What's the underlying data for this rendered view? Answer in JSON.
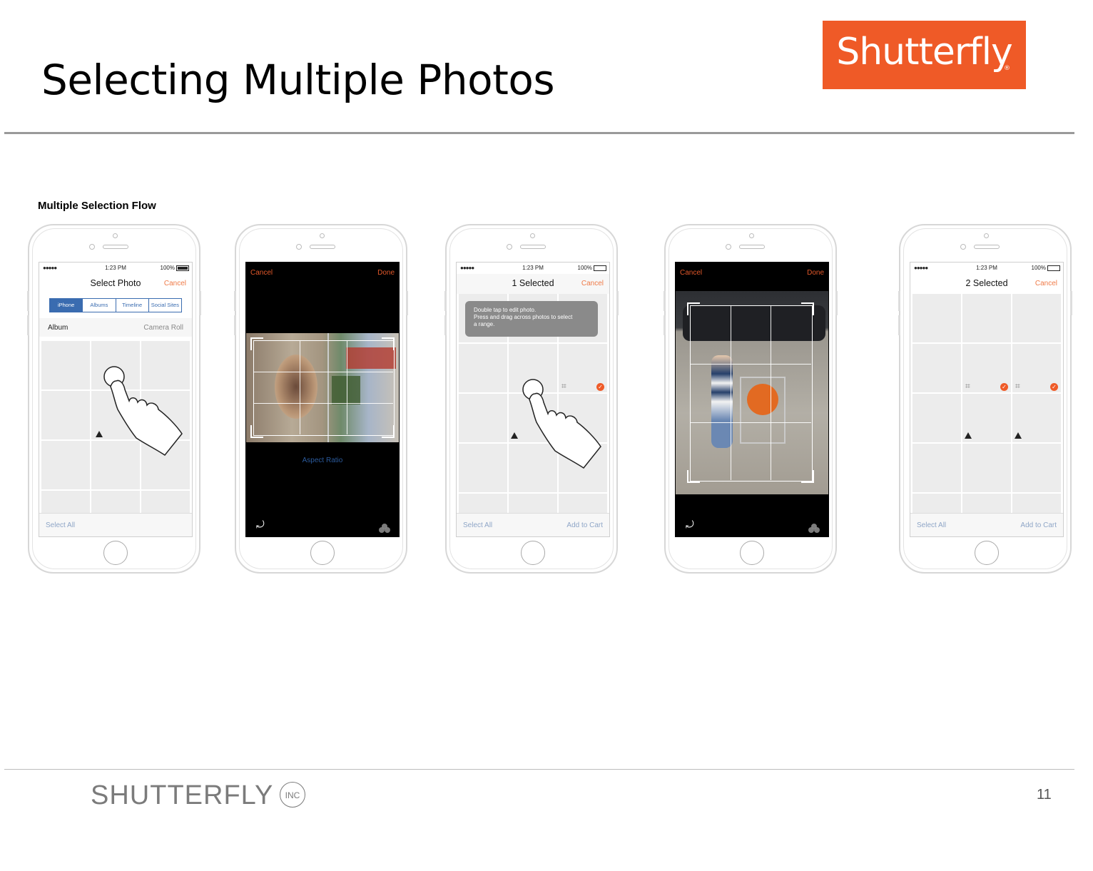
{
  "slide": {
    "title": "Selecting Multiple Photos",
    "page_number": "11"
  },
  "logo": {
    "text": "Shutterfly",
    "reg": "®",
    "color": "#ef5a27"
  },
  "footer": {
    "brand": "SHUTTERFLY",
    "inc": "INC"
  },
  "flow_heading": "Multiple Selection Flow",
  "colors": {
    "accent": "#ef5a27",
    "link_blue": "#3a6cb0",
    "toolbar_text": "#8fa6c7"
  },
  "phones": {
    "p1": {
      "status": {
        "dots": "●●●●●",
        "time": "1:23 PM",
        "battery": "100%"
      },
      "title": "Select Photo",
      "cancel": "Cancel",
      "segments": [
        "iPhone",
        "Albums",
        "Timeline",
        "Social Sites"
      ],
      "album_label": "Album",
      "album_value": "Camera Roll",
      "toolbar_left": "Select All"
    },
    "p2": {
      "cancel": "Cancel",
      "done": "Done",
      "aspect": "Aspect Ratio"
    },
    "p3": {
      "status": {
        "dots": "●●●●●",
        "time": "1:23 PM",
        "battery": "100%"
      },
      "title": "1 Selected",
      "cancel": "Cancel",
      "tooltip_line1": "Double tap to edit photo.",
      "tooltip_line2": "Press and drag across photos to select",
      "tooltip_line3": "a range.",
      "toolbar_left": "Select All",
      "toolbar_right": "Add to Cart"
    },
    "p4": {
      "cancel": "Cancel",
      "done": "Done"
    },
    "p5": {
      "status": {
        "dots": "●●●●●",
        "time": "1:23 PM",
        "battery": "100%"
      },
      "title": "2 Selected",
      "cancel": "Cancel",
      "toolbar_left": "Select All",
      "toolbar_right": "Add to Cart"
    }
  }
}
